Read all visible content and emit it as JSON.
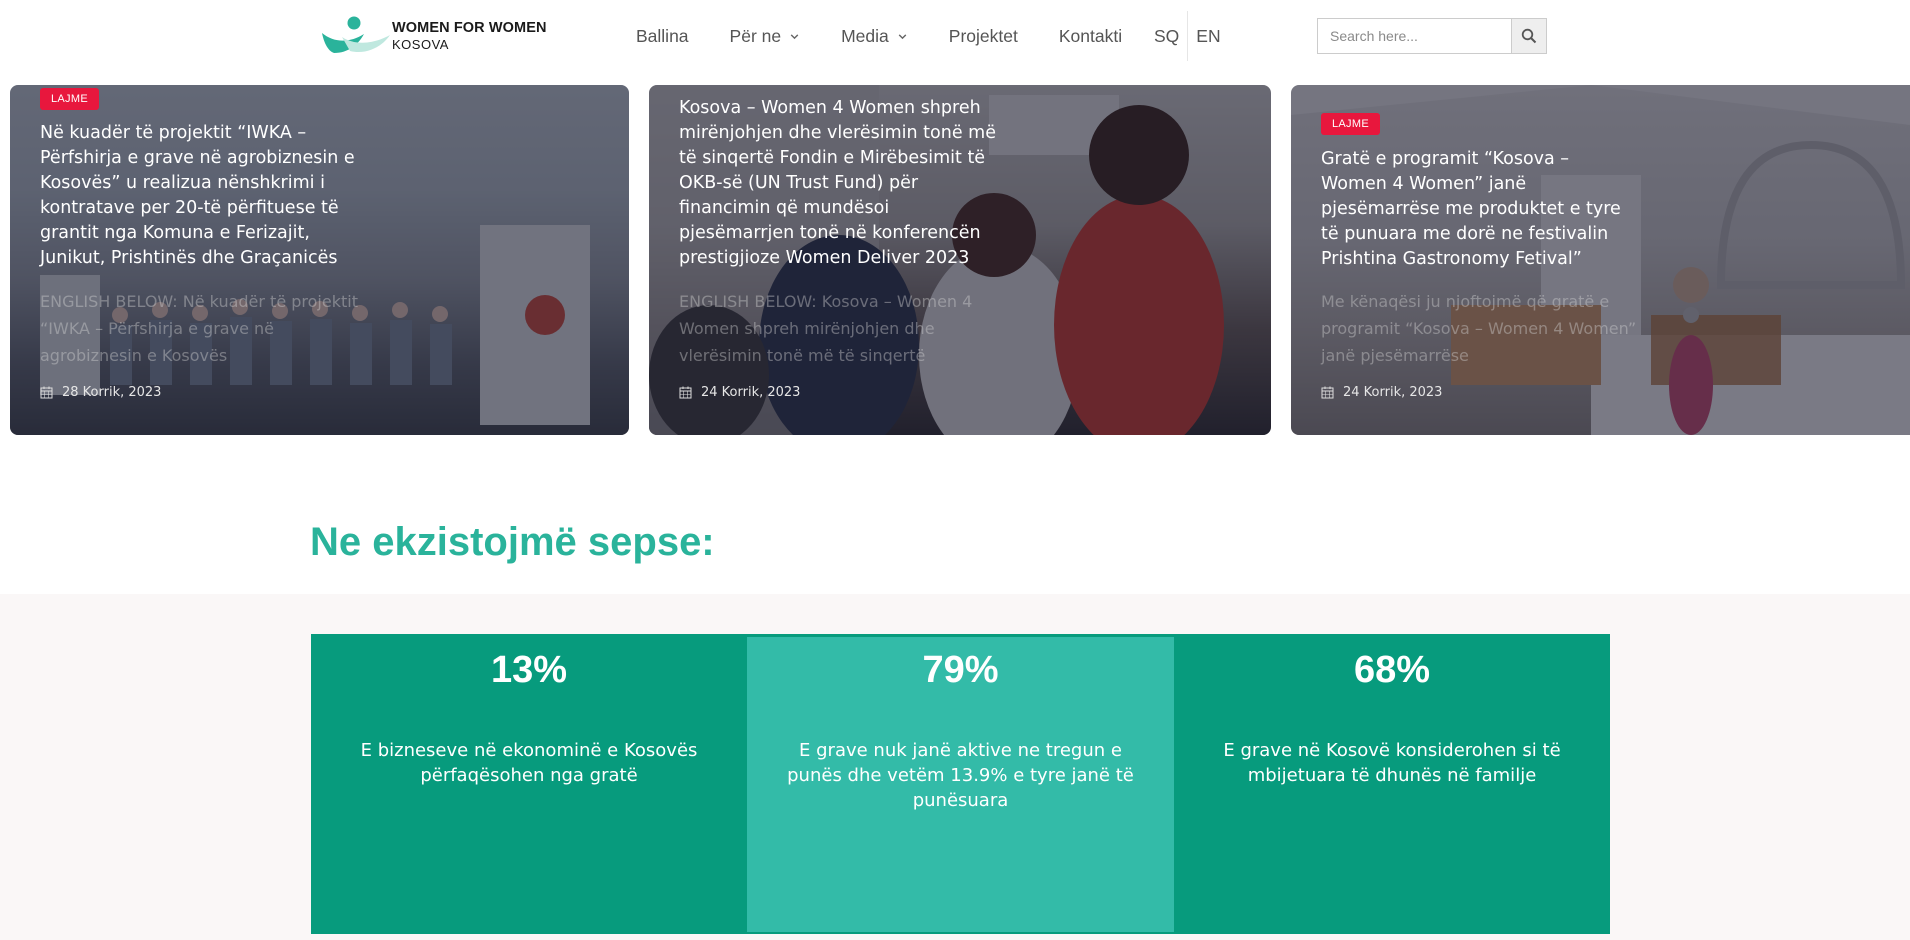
{
  "brand": {
    "name_main": "WOMEN FOR WOMEN",
    "name_sub": "KOSOVA",
    "color_teal": "#2ab39b",
    "color_dark_teal": "#079b7d"
  },
  "nav": {
    "items": [
      {
        "label": "Ballina",
        "has_dropdown": false
      },
      {
        "label": "Për ne",
        "has_dropdown": true
      },
      {
        "label": "Media",
        "has_dropdown": true
      },
      {
        "label": "Projektet",
        "has_dropdown": false
      },
      {
        "label": "Kontakti",
        "has_dropdown": false
      }
    ],
    "lang_sq": "SQ",
    "lang_en": "EN"
  },
  "search": {
    "placeholder": "Search here...",
    "icon": "search-icon"
  },
  "cards": [
    {
      "badge": "LAJME",
      "title": "Në kuadër të projektit “IWKA – Përfshirja e grave në agrobiznesin e Kosovës” u realizua nënshkrimi i kontratave per 20-të përfituese të grantit nga Komuna e Ferizajit, Junikut, Prishtinës dhe Graçanicës",
      "excerpt": "ENGLISH BELOW: Në kuadër të projektit “IWKA – Përfshirja e grave në agrobiznesin e Kosovës",
      "date": "28 Korrik, 2023"
    },
    {
      "badge": "",
      "title": "Kosova – Women 4 Women shpreh mirënjohjen dhe vlerësimin tonë më të sinqertë Fondin e Mirëbesimit të OKB-së (UN Trust Fund) për financimin që mundësoi pjesëmarrjen tonë në konferencën prestigjioze Women Deliver 2023",
      "excerpt": "ENGLISH BELOW: Kosova – Women 4 Women shpreh mirënjohjen dhe vlerësimin tonë më të sinqertë",
      "date": "24 Korrik, 2023"
    },
    {
      "badge": "LAJME",
      "title": "Gratë e programit “Kosova – Women 4 Women” janë pjesëmarrëse me produktet e tyre të punuara me dorë ne festivalin Prishtina Gastronomy Fetival”",
      "excerpt": "Me kënaqësi ju njoftojmë që gratë e programit “Kosova – Women 4 Women” janë pjesëmarrëse",
      "date": "24 Korrik, 2023"
    }
  ],
  "section": {
    "title": "Ne ekzistojmë sepse:"
  },
  "stats": [
    {
      "value": "13%",
      "text": "E bizneseve në ekonominë e Kosovës përfaqësohen nga gratë"
    },
    {
      "value": "79%",
      "text": "E grave nuk janë aktive ne tregun e punës dhe vetëm 13.9% e tyre janë të punësuara"
    },
    {
      "value": "68%",
      "text": "E grave në Kosovë konsiderohen si të mbijetuara të dhunës në familje"
    }
  ]
}
